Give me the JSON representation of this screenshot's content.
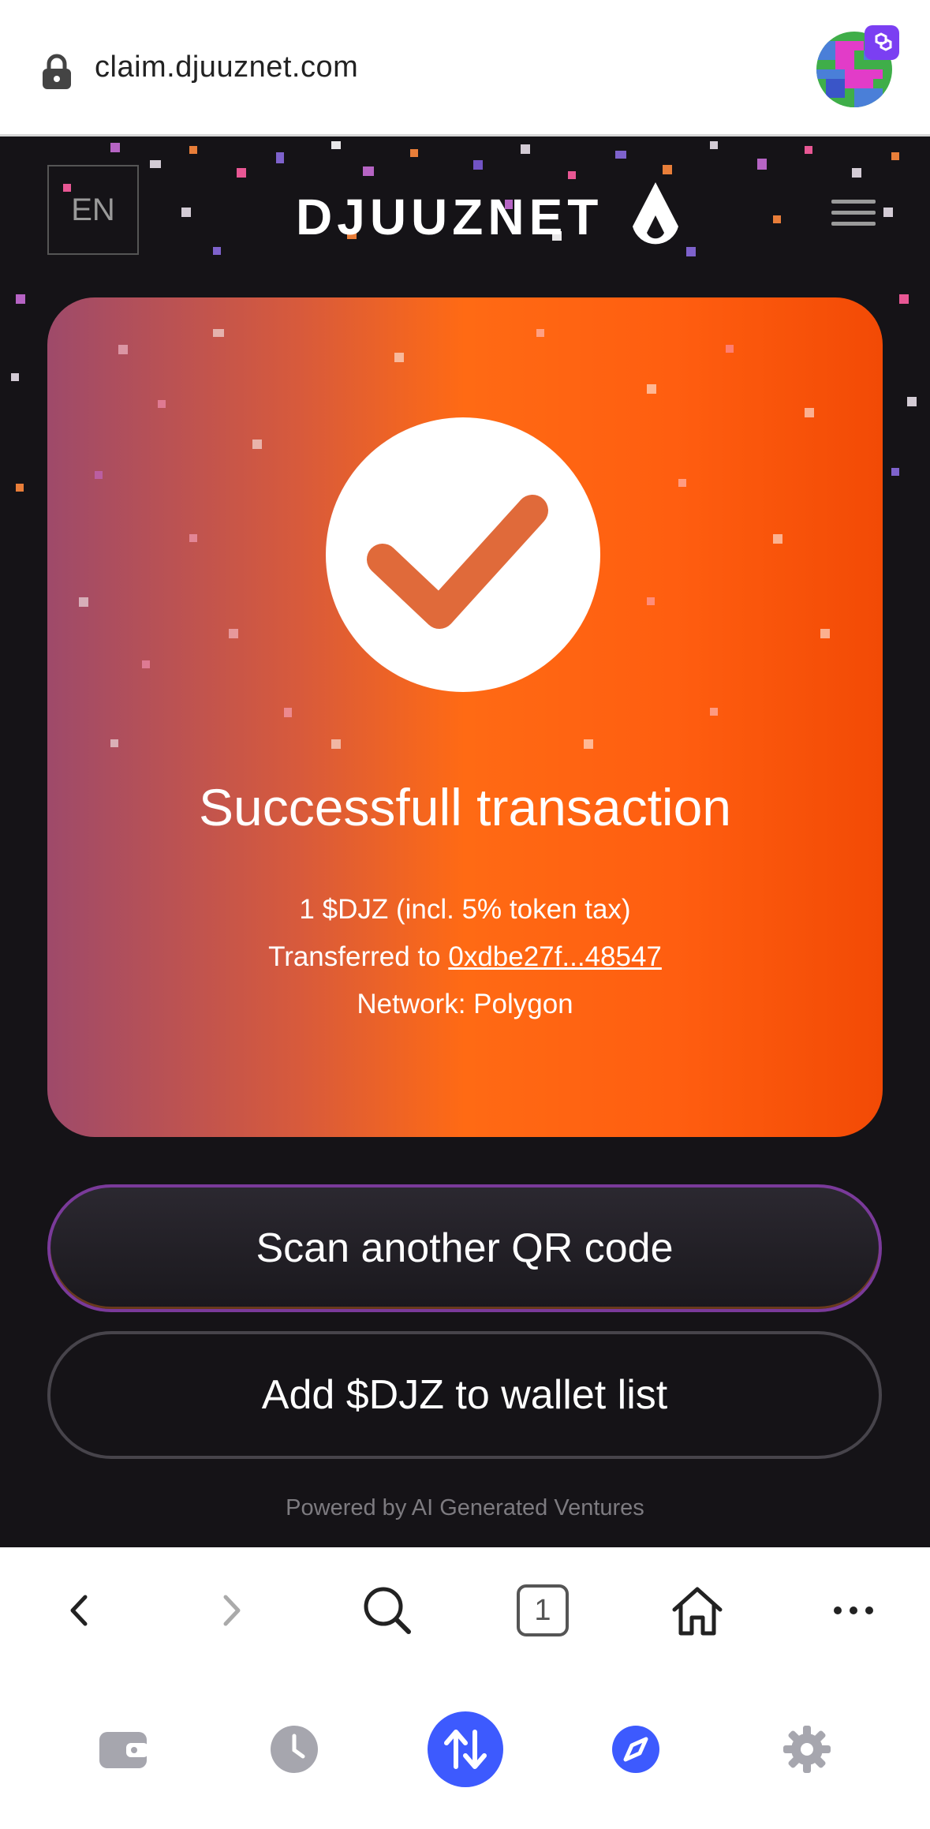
{
  "browser": {
    "url": "claim.djuuznet.com"
  },
  "site": {
    "language": "EN",
    "brand": "DJUUZNET"
  },
  "result": {
    "title": "Successfull transaction",
    "amount_line": "1 $DJZ (incl. 5% token tax)",
    "transfer_prefix": "Transferred to ",
    "address": "0xdbe27f...48547",
    "network_line": "Network: Polygon"
  },
  "actions": {
    "scan_label": "Scan another QR code",
    "add_label": "Add $DJZ to wallet list"
  },
  "footer": {
    "powered_by": "Powered by AI Generated Ventures"
  },
  "toolbar": {
    "tab_count": "1"
  },
  "colors": {
    "card_gradient_start": "#9e4a6a",
    "card_gradient_end": "#f24a05",
    "page_background": "#151317",
    "wallet_accent": "#3d5afe",
    "primary_button_border": "#7a3a9a"
  },
  "icons": {
    "lock": "lock-icon",
    "menu": "hamburger-menu-icon",
    "check": "checkmark-icon",
    "back": "chevron-left-icon",
    "forward": "chevron-right-icon",
    "search": "search-icon",
    "tabs": "tabs-count-icon",
    "home": "home-icon",
    "more": "more-horizontal-icon",
    "wallet": "wallet-icon",
    "history": "clock-icon",
    "swap": "swap-arrows-icon",
    "browser": "compass-icon",
    "settings": "gear-icon"
  }
}
